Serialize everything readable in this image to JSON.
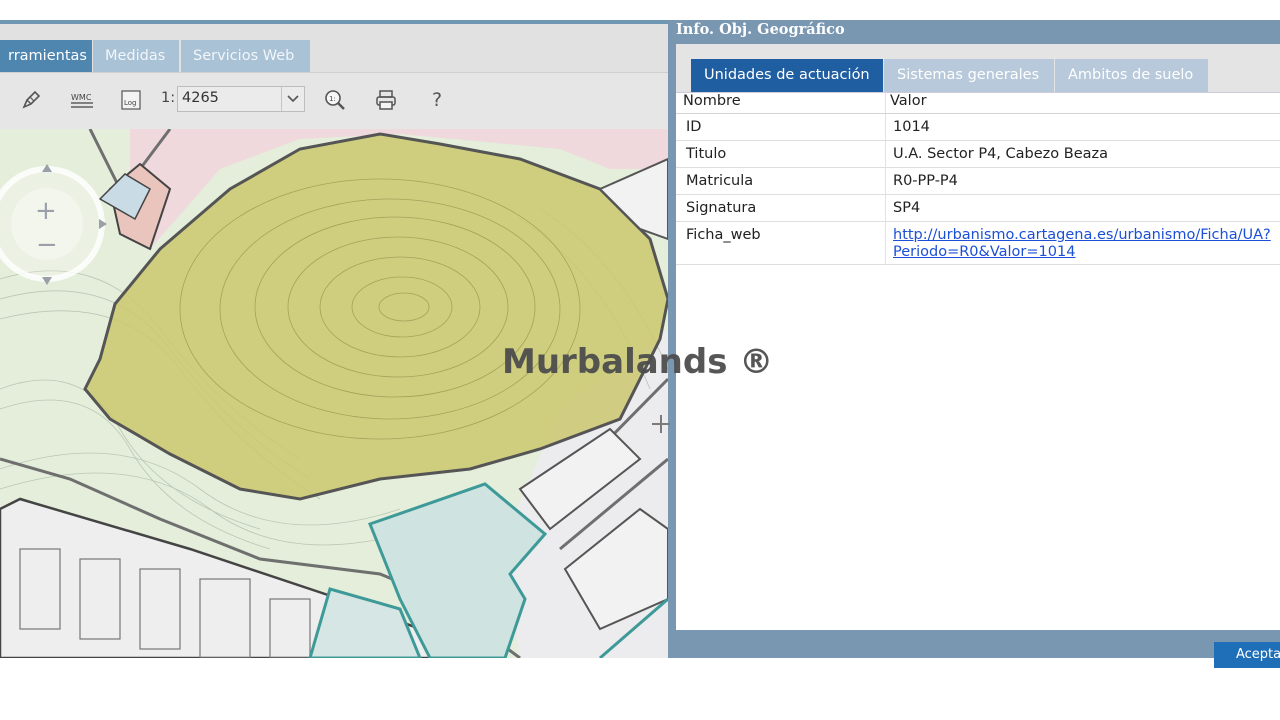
{
  "app": {
    "tabs": [
      {
        "label": "rramientas",
        "active": true
      },
      {
        "label": "Medidas",
        "active": false
      },
      {
        "label": "Servicios Web",
        "active": false
      }
    ],
    "toolbar": {
      "scale_prefix": "1:",
      "scale_value": "4265",
      "help_label": "?",
      "icons": [
        "pen-icon",
        "wmc-icon",
        "log-icon",
        "zoom-scale-icon",
        "print-icon",
        "help-icon"
      ]
    }
  },
  "dialog": {
    "title": "Info. Obj. Geográfico",
    "tabs": [
      {
        "label": "Unidades de actuación",
        "active": true
      },
      {
        "label": "Sistemas generales",
        "active": false
      },
      {
        "label": "Ambitos de suelo",
        "active": false
      }
    ],
    "table": {
      "headers": {
        "name": "Nombre",
        "value": "Valor"
      },
      "rows": [
        {
          "name": "ID",
          "value": "1014"
        },
        {
          "name": "Titulo",
          "value": "U.A. Sector P4, Cabezo Beaza"
        },
        {
          "name": "Matricula",
          "value": "R0-PP-P4"
        },
        {
          "name": "Signatura",
          "value": "SP4"
        }
      ],
      "link_row": {
        "name": "Ficha_web",
        "line1": "http://urbanismo.cartagena.es/urbanismo/Ficha/UA?",
        "line2": "Periodo=R0&Valor=1014"
      }
    },
    "ok_button": "Acepta"
  },
  "watermark": "Murbalands ®",
  "colors": {
    "tab_active": "#4f86b0",
    "dialog_tab_active": "#1f5ea0",
    "dialog_frame": "#7a97b2",
    "map_highlight": "#c9c56a",
    "link": "#1a4fd6"
  }
}
